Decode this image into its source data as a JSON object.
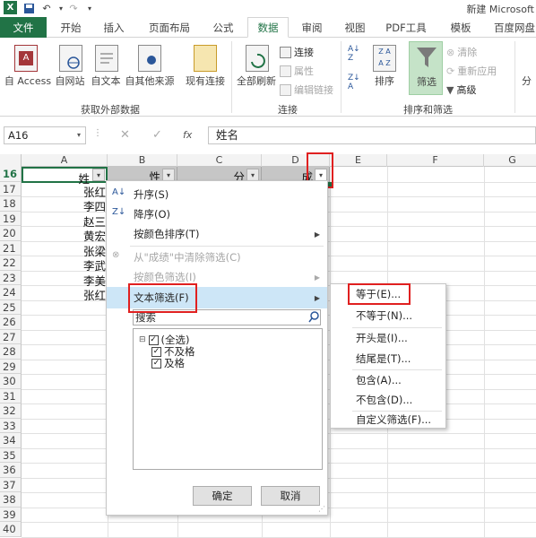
{
  "title_bar": {
    "app_title": "新建 Microsoft"
  },
  "tabs": [
    {
      "label": "文件"
    },
    {
      "label": "开始"
    },
    {
      "label": "插入"
    },
    {
      "label": "页面布局"
    },
    {
      "label": "公式"
    },
    {
      "label": "数据"
    },
    {
      "label": "审阅"
    },
    {
      "label": "视图"
    },
    {
      "label": "PDF工具"
    },
    {
      "label": "模板"
    },
    {
      "label": "百度网盘"
    }
  ],
  "ribbon": {
    "get_external": {
      "buttons": [
        "自 Access",
        "自网站",
        "自文本",
        "自其他来源"
      ],
      "existing": "现有连接",
      "group_title": "获取外部数据"
    },
    "connections": {
      "refresh_all": "全部刷新",
      "connections": "连接",
      "properties": "属性",
      "edit_links": "编辑链接",
      "group_title": "连接"
    },
    "sort_filter": {
      "sort": "排序",
      "filter": "筛选",
      "clear": "清除",
      "reapply": "重新应用",
      "advanced": "高级",
      "group_title": "排序和筛选",
      "more": "分"
    }
  },
  "formula_bar": {
    "name_box": "A16",
    "formula": "姓名",
    "fx": "fx"
  },
  "grid": {
    "columns": [
      "A",
      "B",
      "C",
      "D",
      "E",
      "F",
      "G"
    ],
    "rows": [
      "16",
      "17",
      "18",
      "19",
      "20",
      "21",
      "22",
      "23",
      "24",
      "25",
      "26",
      "27",
      "28",
      "29",
      "30",
      "31",
      "32",
      "33",
      "34",
      "35",
      "36",
      "37",
      "38",
      "39",
      "40"
    ],
    "header_cells": [
      "姓",
      "性",
      "分",
      "成"
    ],
    "names": [
      "张红",
      "李四",
      "赵三",
      "黄宏",
      "张梁",
      "李武",
      "李美",
      "张红"
    ]
  },
  "filter_menu": {
    "sort_asc": "升序(S)",
    "sort_desc": "降序(O)",
    "sort_by_color": "按颜色排序(T)",
    "clear_filter": "从\"成绩\"中清除筛选(C)",
    "filter_by_color": "按颜色筛选(I)",
    "text_filter": "文本筛选(F)",
    "search_placeholder": "搜索",
    "tree": [
      "(全选)",
      "不及格",
      "及格"
    ],
    "ok": "确定",
    "cancel": "取消"
  },
  "text_filter_submenu": [
    "等于(E)...",
    "不等于(N)...",
    "开头是(I)...",
    "结尾是(T)...",
    "包含(A)...",
    "不包含(D)...",
    "自定义筛选(F)..."
  ],
  "colors": {
    "excel_green": "#217346",
    "highlight": "#cde6f7",
    "callout_red": "#e02020"
  }
}
